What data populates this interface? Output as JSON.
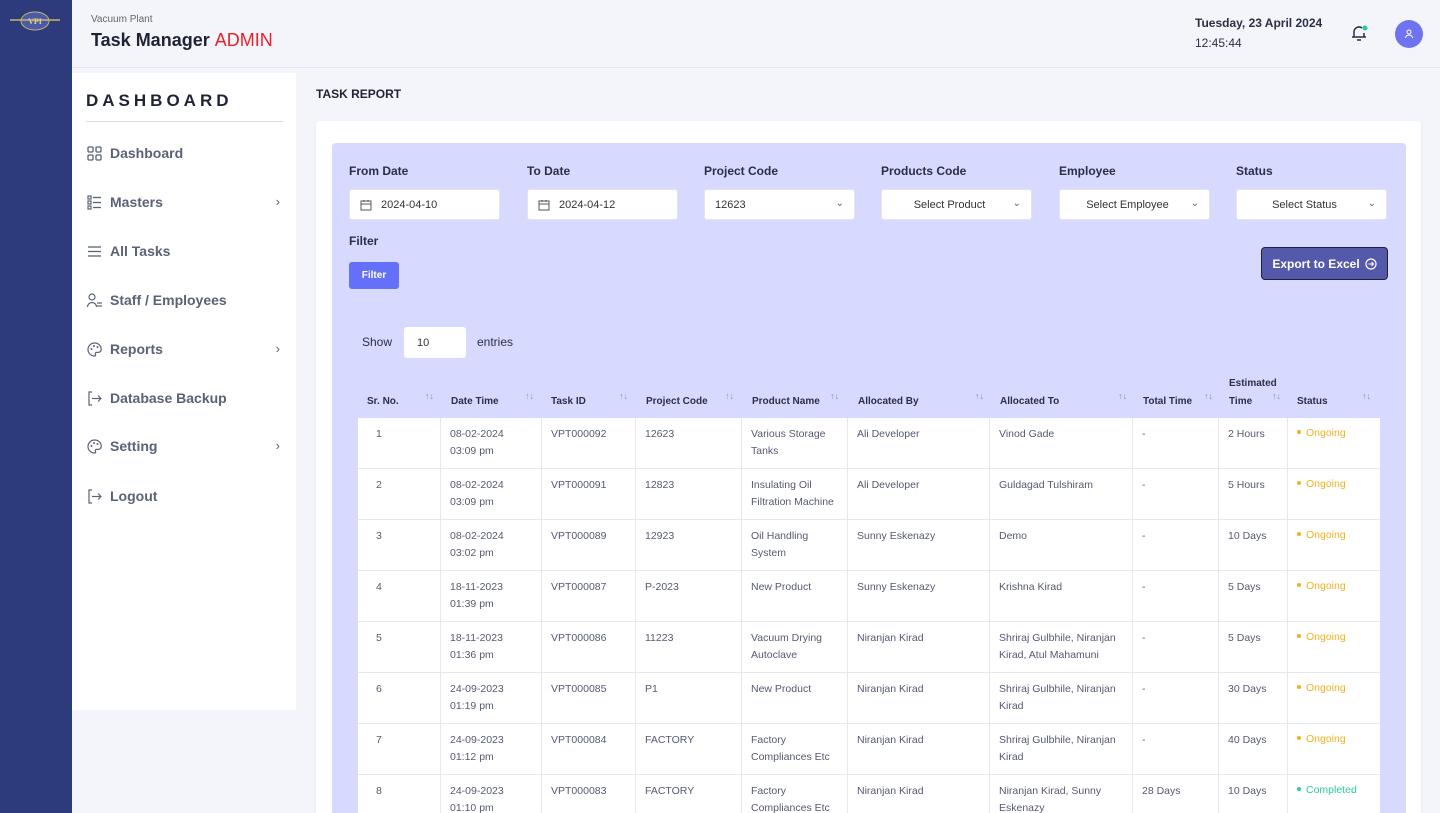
{
  "header": {
    "plant": "Vacuum Plant",
    "app_name": "Task Manager",
    "app_role": "ADMIN",
    "date": "Tuesday, 23 April 2024",
    "time": "12:45:44"
  },
  "sidebar": {
    "title": "DASHBOARD",
    "items": [
      {
        "label": "Dashboard",
        "icon": "grid-icon"
      },
      {
        "label": "Masters",
        "icon": "list-icon",
        "has_children": true
      },
      {
        "label": "All Tasks",
        "icon": "lines-icon"
      },
      {
        "label": "Staff / Employees",
        "icon": "user-list-icon"
      },
      {
        "label": "Reports",
        "icon": "palette-icon",
        "has_children": true
      },
      {
        "label": "Database Backup",
        "icon": "logout-icon"
      },
      {
        "label": "Setting",
        "icon": "palette-icon",
        "has_children": true
      },
      {
        "label": "Logout",
        "icon": "logout-icon"
      }
    ]
  },
  "page": {
    "title": "TASK REPORT"
  },
  "filters": {
    "from_date_label": "From Date",
    "from_date": "2024-04-10",
    "to_date_label": "To Date",
    "to_date": "2024-04-12",
    "project_label": "Project Code",
    "project_value": "12623",
    "product_label": "Products Code",
    "product_value": "Select Product",
    "employee_label": "Employee",
    "employee_value": "Select Employee",
    "status_label": "Status",
    "status_value": "Select Status",
    "filter_label": "Filter",
    "filter_button": "Filter",
    "export_button": "Export to Excel"
  },
  "entries": {
    "show": "Show",
    "value": "10",
    "suffix": "entries"
  },
  "table": {
    "columns": [
      "Sr. No.",
      "Date Time",
      "Task ID",
      "Project Code",
      "Product Name",
      "Allocated By",
      "Allocated To",
      "Total Time",
      "Estimated",
      "Time",
      "Status"
    ],
    "rows": [
      {
        "sr": "1",
        "date": "08-02-2024",
        "time": "03:09 pm",
        "task": "VPT000092",
        "project": "12623",
        "product": [
          "Various Storage",
          "Tanks"
        ],
        "by": "Ali Developer",
        "to": [
          "Vinod Gade"
        ],
        "total": "-",
        "est": "2 Hours",
        "status": "Ongoing"
      },
      {
        "sr": "2",
        "date": "08-02-2024",
        "time": "03:09 pm",
        "task": "VPT000091",
        "project": "12823",
        "product": [
          "Insulating Oil",
          "Filtration Machine"
        ],
        "by": "Ali Developer",
        "to": [
          "Guldagad Tulshiram"
        ],
        "total": "-",
        "est": "5 Hours",
        "status": "Ongoing"
      },
      {
        "sr": "3",
        "date": "08-02-2024",
        "time": "03:02 pm",
        "task": "VPT000089",
        "project": "12923",
        "product": [
          "Oil Handling",
          "System"
        ],
        "by": "Sunny Eskenazy",
        "to": [
          "Demo"
        ],
        "total": "-",
        "est": "10 Days",
        "status": "Ongoing"
      },
      {
        "sr": "4",
        "date": "18-11-2023",
        "time": "01:39 pm",
        "task": "VPT000087",
        "project": "P-2023",
        "product": [
          "New Product"
        ],
        "by": "Sunny Eskenazy",
        "to": [
          "Krishna Kirad"
        ],
        "total": "-",
        "est": "5 Days",
        "status": "Ongoing"
      },
      {
        "sr": "5",
        "date": "18-11-2023",
        "time": "01:36 pm",
        "task": "VPT000086",
        "project": "11223",
        "product": [
          "Vacuum Drying",
          "Autoclave"
        ],
        "by": "Niranjan Kirad",
        "to": [
          "Shriraj Gulbhile, Niranjan",
          "Kirad, Atul Mahamuni"
        ],
        "total": "-",
        "est": "5 Days",
        "status": "Ongoing"
      },
      {
        "sr": "6",
        "date": "24-09-2023",
        "time": "01:19 pm",
        "task": "VPT000085",
        "project": "P1",
        "product": [
          "New Product"
        ],
        "by": "Niranjan Kirad",
        "to": [
          "Shriraj Gulbhile, Niranjan",
          "Kirad"
        ],
        "total": "-",
        "est": "30 Days",
        "status": "Ongoing"
      },
      {
        "sr": "7",
        "date": "24-09-2023",
        "time": "01:12 pm",
        "task": "VPT000084",
        "project": "FACTORY",
        "product": [
          "Factory",
          "Compliances Etc"
        ],
        "by": "Niranjan Kirad",
        "to": [
          "Shriraj Gulbhile, Niranjan",
          "Kirad"
        ],
        "total": "-",
        "est": "40 Days",
        "status": "Ongoing"
      },
      {
        "sr": "8",
        "date": "24-09-2023",
        "time": "01:10 pm",
        "task": "VPT000083",
        "project": "FACTORY",
        "product": [
          "Factory",
          "Compliances Etc"
        ],
        "by": "Niranjan Kirad",
        "to": [
          "Niranjan Kirad, Sunny",
          "Eskenazy"
        ],
        "total": "28 Days",
        "est": "10 Days",
        "status": "Completed"
      }
    ]
  },
  "colors": {
    "ongoing": "#f2b01e",
    "completed": "#2fc8a0",
    "accent": "#6370f7",
    "rail": "#2d3a7b"
  }
}
